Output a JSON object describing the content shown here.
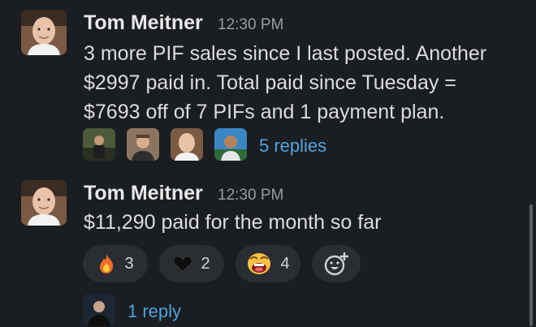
{
  "messages": [
    {
      "author": "Tom Meitner",
      "time": "12:30 PM",
      "lines": [
        "3 more PIF sales since I last posted. Another",
        "$2997 paid in. Total paid since Tuesday =",
        "$7693 off of 7 PIFs and 1 payment plan."
      ],
      "thread": {
        "replies_label": "5 replies"
      }
    },
    {
      "author": "Tom Meitner",
      "time": "12:30 PM",
      "lines": [
        "$11,290 paid for the month so far"
      ],
      "reactions": [
        {
          "emoji": "fire-emoji",
          "count": "3"
        },
        {
          "emoji": "black-heart-emoji",
          "count": "2"
        },
        {
          "emoji": "excited-face-emoji",
          "count": "4"
        }
      ],
      "thread": {
        "replies_label": "1 reply"
      }
    }
  ],
  "colors": {
    "background": "#1a1d21",
    "link": "#4fa3e0",
    "reaction_bg": "#2a2d31"
  }
}
